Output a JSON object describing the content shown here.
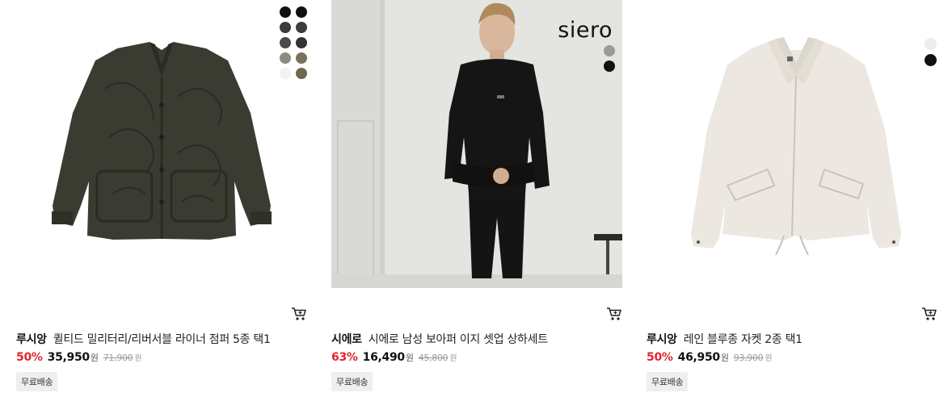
{
  "products": [
    {
      "brand": "루시앙",
      "name": "퀼티드 밀리터리/리버서블 라이너 점퍼 5종 택1",
      "discount": "50%",
      "price": "35,950",
      "price_unit": "원",
      "original_price": "71,900",
      "original_unit": "원",
      "badge": "무료배송",
      "image_icon": "olive-quilted-jacket",
      "swatch_colors": [
        "#111111",
        "#111111",
        "#3a3a3a",
        "#3d3d3d",
        "#4a4a4a",
        "#333333",
        "#8c8c82",
        "#7a715c",
        "#f2f2f2",
        "#6e6650"
      ]
    },
    {
      "brand": "시에로",
      "name": "시에로 남성 보아퍼 이지 셋업 상하세트",
      "discount": "63%",
      "price": "16,490",
      "price_unit": "원",
      "original_price": "45,800",
      "original_unit": "원",
      "badge": "무료배송",
      "image_brand_logo": "siero",
      "image_icon": "model-black-setup",
      "swatch_colors": [
        "#9a9a9a",
        "#111111"
      ]
    },
    {
      "brand": "루시앙",
      "name": "레인 블루종 자켓 2종 택1",
      "discount": "50%",
      "price": "46,950",
      "price_unit": "원",
      "original_price": "93,900",
      "original_unit": "원",
      "badge": "무료배송",
      "image_icon": "ivory-blouson-jacket",
      "swatch_colors": [
        "#ededed",
        "#111111"
      ]
    }
  ],
  "colors": {
    "discount": "#e1262d",
    "badge_bg": "#efefef"
  }
}
